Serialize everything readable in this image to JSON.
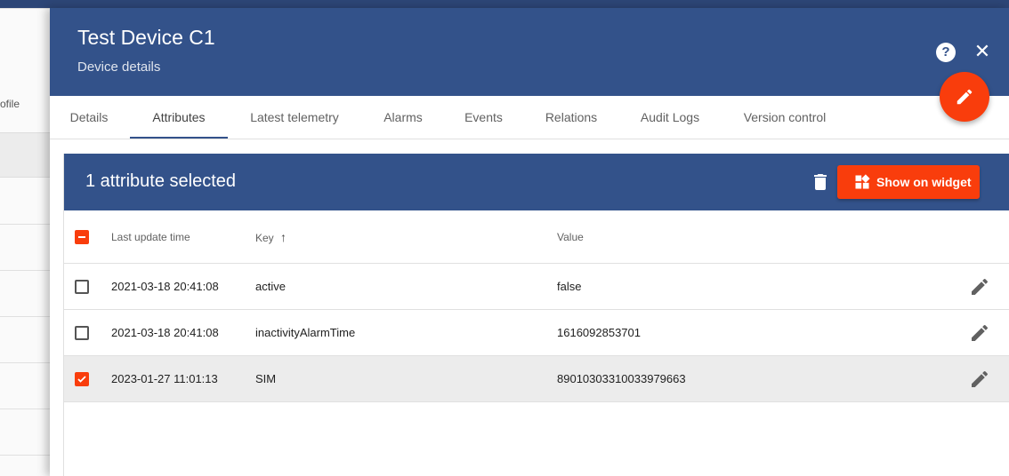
{
  "background": {
    "profile_label": "ofile"
  },
  "drawer": {
    "title": "Test Device C1",
    "subtitle": "Device details",
    "help_icon": "help-circle-icon",
    "help_glyph": "?",
    "close_icon": "close-icon",
    "close_glyph": "✕",
    "fab_icon": "pencil-icon"
  },
  "tabs": [
    {
      "label": "Details"
    },
    {
      "label": "Attributes",
      "active": true
    },
    {
      "label": "Latest telemetry"
    },
    {
      "label": "Alarms"
    },
    {
      "label": "Events"
    },
    {
      "label": "Relations"
    },
    {
      "label": "Audit Logs"
    },
    {
      "label": "Version control"
    }
  ],
  "attributes": {
    "selection_text": "1 attribute selected",
    "delete_icon": "trash-icon",
    "show_widget_label": "Show on widget",
    "show_widget_icon": "widgets-icon",
    "columns": {
      "last_update": "Last update time",
      "key": "Key",
      "key_sort": "↑",
      "value": "Value"
    },
    "rows": [
      {
        "time": "2021-03-18 20:41:08",
        "key": "active",
        "value": "false",
        "selected": false
      },
      {
        "time": "2021-03-18 20:41:08",
        "key": "inactivityAlarmTime",
        "value": "1616092853701",
        "selected": false
      },
      {
        "time": "2023-01-27 11:01:13",
        "key": "SIM",
        "value": "89010303310033979663",
        "selected": true
      }
    ]
  },
  "colors": {
    "header": "#33528a",
    "accent": "#f93d0c",
    "selected_row": "#ececec"
  }
}
